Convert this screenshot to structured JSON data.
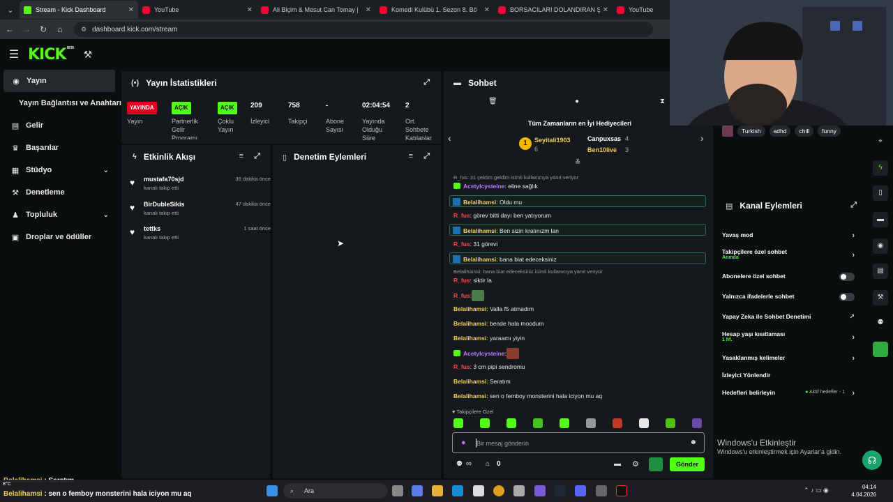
{
  "browser": {
    "tabs": [
      {
        "label": "Stream - Kick Dashboard",
        "icon": "kick"
      },
      {
        "label": "YouTube",
        "icon": "yt"
      },
      {
        "label": "Ali Biçim & Mesut Can Tomay |",
        "icon": "yt"
      },
      {
        "label": "Komedi Kulübü 1. Sezon 8. Bö",
        "icon": "yt"
      },
      {
        "label": "BORSACILARI DOLANDIRAN ŞI",
        "icon": "yt"
      },
      {
        "label": "YouTube",
        "icon": "yt"
      }
    ],
    "url": "dashboard.kick.com/stream"
  },
  "header": {
    "logo": "KICK",
    "beta": "BETA"
  },
  "sidebar": {
    "items": [
      {
        "label": "Yayın",
        "icon": "stream-icon"
      },
      {
        "label": "Yayın Bağlantısı ve Anahtarı",
        "icon": ""
      },
      {
        "label": "Gelir",
        "icon": "revenue-icon"
      },
      {
        "label": "Başarılar",
        "icon": "trophy-icon"
      },
      {
        "label": "Stüdyo",
        "icon": "studio-icon"
      },
      {
        "label": "Denetleme",
        "icon": "moderation-icon"
      },
      {
        "label": "Topluluk",
        "icon": "community-icon"
      },
      {
        "label": "Droplar ve ödüller",
        "icon": "drops-icon"
      }
    ]
  },
  "stats_panel": {
    "title": "Yayın İstatistikleri",
    "live_badge": "YAYINDA",
    "on_badge": "AÇIK",
    "stats": [
      {
        "value": "",
        "label": "Yayın"
      },
      {
        "value": "",
        "label": "Partnerlik Gelir Programı"
      },
      {
        "value": "",
        "label": "Çoklu Yayın"
      },
      {
        "value": "209",
        "label": "İzleyici"
      },
      {
        "value": "758",
        "label": "Takipçi"
      },
      {
        "value": "-",
        "label": "Abone Sayısı"
      },
      {
        "value": "02:04:54",
        "label": "Yayında Olduğu Süre"
      },
      {
        "value": "2",
        "label": "Ort. Sohbete Katılanlar"
      }
    ]
  },
  "activity_feed": {
    "title": "Etkinlik Akışı",
    "items": [
      {
        "name": "mustafa70sjd",
        "action": "kanalı takip etti",
        "time": "36 dakika önce"
      },
      {
        "name": "BirDubleSikis",
        "action": "kanalı takip etti",
        "time": "47 dakika önce"
      },
      {
        "name": "tettks",
        "action": "kanalı takip etti",
        "time": "1 saat önce"
      }
    ]
  },
  "moderation_panel": {
    "title": "Denetim Eylemleri"
  },
  "chat": {
    "title": "Sohbet",
    "gifters_title": "Tüm Zamanların en İyi Hediyecileri",
    "gifters": [
      {
        "rank": "1",
        "name": "Seyitali1903",
        "count": "6"
      },
      {
        "rank": "2",
        "name": "Canpuxsas",
        "count": "4"
      },
      {
        "rank": "3",
        "name": "Ben10live",
        "count": "3"
      }
    ],
    "messages": [
      {
        "type": "reply",
        "text": "R_fus: 31 çektim geldim isimli kullanıcıya yanıt veriyor"
      },
      {
        "type": "normal",
        "user": "Acetylcysteine",
        "text": ": eline sağlık",
        "color": "pur",
        "badge": "sub"
      },
      {
        "type": "hl",
        "user": "Belalihamsi",
        "text": ": Oldu mu",
        "color": "yel",
        "badge": "mod"
      },
      {
        "type": "normal",
        "user": "R_fus",
        "text": ": görev bitti dayı ben yatıyorum",
        "color": "red"
      },
      {
        "type": "hl",
        "user": "Belalihamsi",
        "text": ": Ben sizin kralınızm lan",
        "color": "yel",
        "badge": "mod"
      },
      {
        "type": "normal",
        "user": "R_fus",
        "text": ": 31 görevi",
        "color": "red"
      },
      {
        "type": "hl",
        "user": "Belalihamsi",
        "text": ": bana biat edeceksiniz",
        "color": "yel",
        "badge": "mod"
      },
      {
        "type": "reply",
        "text": "Belalihamsi: bana biat edeceksiniz isimli kullanıcıya yanıt veriyor"
      },
      {
        "type": "normal",
        "user": "R_fus",
        "text": ": siktir la",
        "color": "red"
      },
      {
        "type": "emote",
        "user": "R_fus",
        "text": ":",
        "color": "red"
      },
      {
        "type": "normal",
        "user": "Belalihamsi",
        "text": ": Valla f5 atmadım",
        "color": "yel"
      },
      {
        "type": "normal",
        "user": "Belalihamsi",
        "text": ": bende hala moodum",
        "color": "yel"
      },
      {
        "type": "normal",
        "user": "Belalihamsi",
        "text": ": yaraamı yiyin",
        "color": "yel"
      },
      {
        "type": "emote2",
        "user": "Acetylcysteine",
        "text": ":",
        "color": "pur",
        "badge": "sub"
      },
      {
        "type": "normal",
        "user": "R_fus",
        "text": ": 3 cm pipi sendromu",
        "color": "red"
      },
      {
        "type": "normal",
        "user": "Belalihamsi",
        "text": ": Seratım",
        "color": "yel"
      },
      {
        "type": "normal",
        "user": "Belalihamsi",
        "text": ": sen o femboy monsterini hala iciyon mu aq",
        "color": "yel"
      }
    ],
    "followers_only": "Takipçilere Özel",
    "placeholder": "Bir mesaj gönderin",
    "points": "0",
    "send": "Gönder",
    "infinite": "∞"
  },
  "tags": [
    "Turkish",
    "adhd",
    "chill",
    "funny"
  ],
  "channel_actions": {
    "title": "Kanal Eylemleri",
    "items": [
      {
        "label": "Yavaş mod",
        "sub": "",
        "control": "chevron"
      },
      {
        "label": "Takipçilere özel sohbet",
        "sub": "Anında",
        "control": "chevron"
      },
      {
        "label": "Abonelere özel sohbet",
        "sub": "",
        "control": "toggle"
      },
      {
        "label": "Yalnızca ifadelerle sohbet",
        "sub": "",
        "control": "toggle"
      },
      {
        "label": "Yapay Zeka ile Sohbet Denetimi",
        "sub": "",
        "control": "external"
      },
      {
        "label": "Hesap yaşı kısıtlaması",
        "sub": "1 hf.",
        "control": "chevron"
      },
      {
        "label": "Yasaklanmış kelimeler",
        "sub": "",
        "control": "chevron"
      },
      {
        "label": "İzleyici Yönlendir",
        "sub": "",
        "control": "none"
      },
      {
        "label": "Hedefleri belirleyin",
        "sub": "",
        "control": "chevron",
        "extra": "Aktif hedefler - 1"
      }
    ]
  },
  "windows": {
    "activate_title": "Windows'u Etkinleştir",
    "activate_sub": "Windows'u etkinleştirmek için Ayarlar'a gidin.",
    "search": "Ara",
    "time": "04:14",
    "date": "4.04.2026",
    "weather": "8°C"
  },
  "overlay": [
    {
      "user": "Belalihamsi",
      "text": " : Seratım"
    },
    {
      "user": "Belalihamsi",
      "text": " : sen o femboy monsterini hala iciyon mu aq"
    }
  ],
  "colors": {
    "accent": "#53fc18",
    "live": "#e00020",
    "panel": "#16191c",
    "bg": "#0b0e0f"
  }
}
